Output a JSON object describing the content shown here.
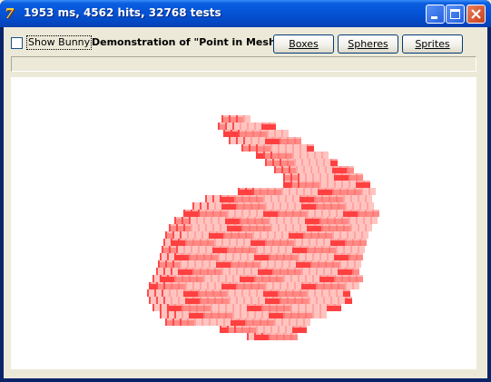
{
  "window": {
    "title": "1953 ms, 4562 hits, 32768 tests",
    "app_icon": "7"
  },
  "toolbar": {
    "show_bunny_label": "Show Bunny",
    "show_bunny_checked": false,
    "heading": "Demonstration of \"Point in Mesh\"",
    "boxes_label": "Boxes",
    "spheres_label": "Spheres",
    "sprites_label": "Sprites"
  },
  "icons": {
    "minimize": "minimize-icon",
    "maximize": "maximize-icon",
    "close": "close-icon"
  },
  "colors": {
    "voxel_light": "#ffc4c0",
    "voxel_mid": "#ff8a86",
    "voxel_dark": "#ff4040"
  }
}
